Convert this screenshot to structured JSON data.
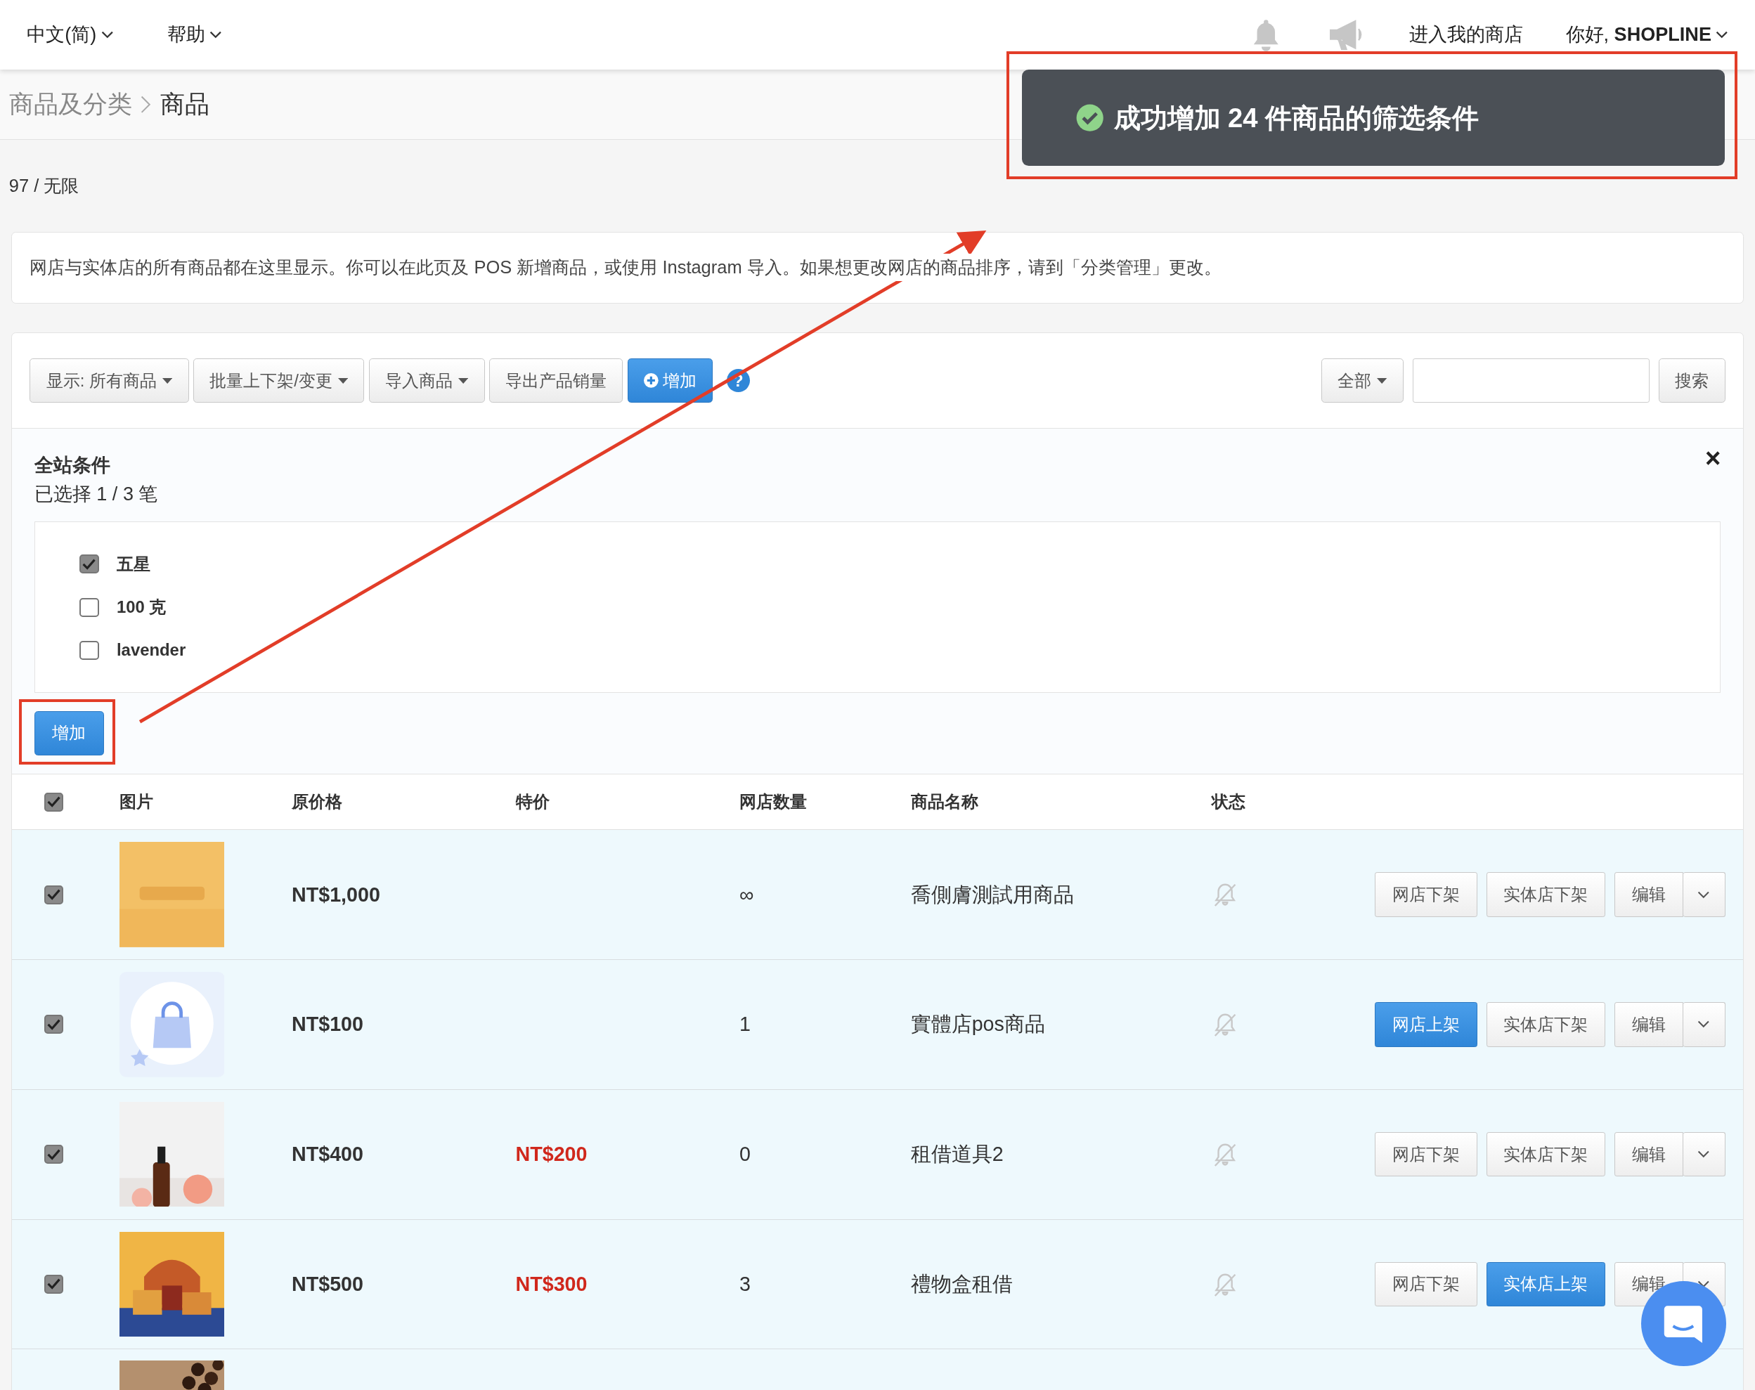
{
  "topbar": {
    "menus": [
      {
        "label": "中文(简)"
      },
      {
        "label": "帮助"
      }
    ],
    "store_link": "进入我的商店",
    "greeting": "你好, **SHOPLINE**"
  },
  "breadcrumb": [
    {
      "label": "商品及分类",
      "current": false
    },
    {
      "label": "商品",
      "current": true
    }
  ],
  "toast": {
    "message": "成功增加 24 件商品的筛选条件"
  },
  "quota": "97 / 无限",
  "info": "网店与实体店的所有商品都在这里显示。你可以在此页及 POS 新增商品，或使用 Instagram 导入。如果想更改网店的商品排序，请到「分类管理」更改。",
  "toolbar": {
    "buttons": [
      {
        "label": "显示: 所有商品",
        "kind": "dropdown"
      },
      {
        "label": "批量上下架/变更",
        "kind": "dropdown"
      },
      {
        "label": "导入商品",
        "kind": "dropdown"
      },
      {
        "label": "导出产品销量",
        "kind": "plain"
      },
      {
        "label": "增加",
        "kind": "primary"
      }
    ],
    "help": "?",
    "scope": "全部",
    "search_button": "搜索"
  },
  "filter": {
    "title": "全站条件",
    "count": "已选择 1 / 3 笔",
    "close": "×",
    "options": [
      {
        "label": "五星",
        "checked": true
      },
      {
        "label": "100 克",
        "checked": false
      },
      {
        "label": "lavender",
        "checked": false
      }
    ],
    "add_button": "增加"
  },
  "table": {
    "all_checked": true,
    "columns": [
      "图片",
      "原价格",
      "特价",
      "网店数量",
      "商品名称",
      "状态"
    ],
    "rows": [
      {
        "checked": true,
        "image": {
          "kind": "picture"
        },
        "price": "NT$1,000",
        "quantity": "∞",
        "name": "喬側膚測試用商品",
        "actions": [
          {
            "label": "网店下架",
            "primary": false
          },
          {
            "label": "实体店下架",
            "primary": false
          }
        ],
        "edit": "编辑"
      },
      {
        "checked": true,
        "image": {
          "kind": "placeholder"
        },
        "price": "NT$100",
        "quantity": "1",
        "name": "實體店pos商品",
        "actions": [
          {
            "label": "网店上架",
            "primary": true
          },
          {
            "label": "实体店下架",
            "primary": false
          }
        ],
        "edit": "编辑"
      },
      {
        "checked": true,
        "image": {
          "kind": "picture"
        },
        "price": "NT$400",
        "sale_price": "NT$200",
        "quantity": "0",
        "name": "租借道具2",
        "actions": [
          {
            "label": "网店下架",
            "primary": false
          },
          {
            "label": "实体店下架",
            "primary": false
          }
        ],
        "edit": "编辑"
      },
      {
        "checked": true,
        "image": {
          "kind": "picture"
        },
        "price": "NT$500",
        "sale_price": "NT$300",
        "quantity": "3",
        "name": "禮物盒租借",
        "actions": [
          {
            "label": "网店下架",
            "primary": false
          },
          {
            "label": "实体店上架",
            "primary": true
          }
        ],
        "edit": "编辑"
      },
      {
        "image": {
          "kind": "picture"
        }
      }
    ]
  }
}
